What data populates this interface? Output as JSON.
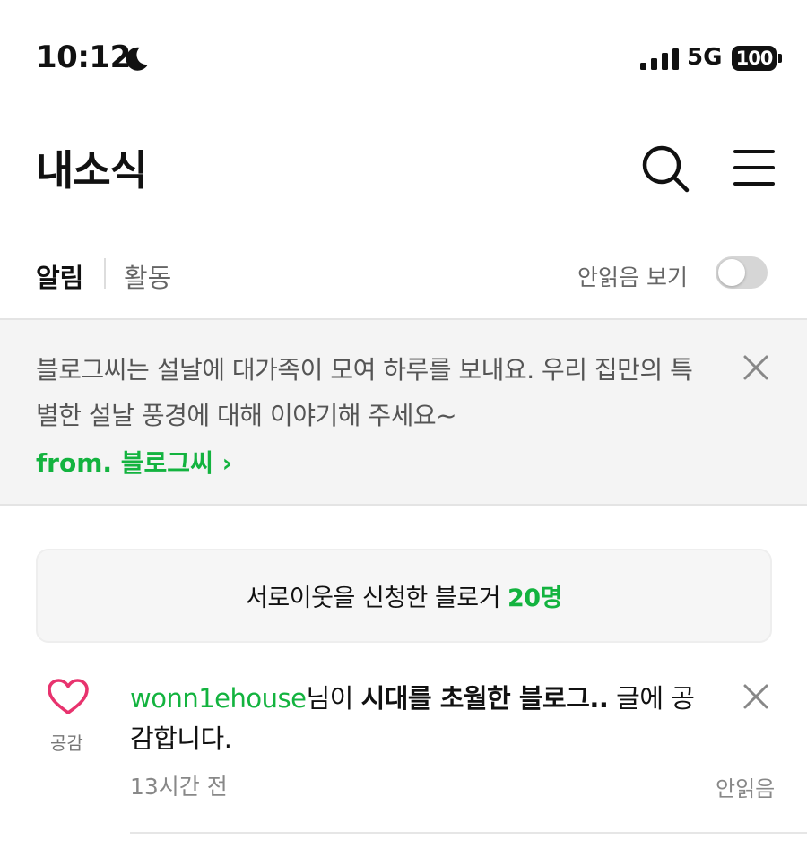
{
  "status_bar": {
    "time": "10:12",
    "network": "5G",
    "battery": "100",
    "icons": [
      "moon-icon",
      "signal-icon",
      "battery-icon"
    ]
  },
  "header": {
    "title": "내소식",
    "icons": [
      "search-icon",
      "menu-icon"
    ]
  },
  "tabs": {
    "alert": "알림",
    "activity": "활동",
    "unread_toggle_label": "안읽음 보기",
    "unread_toggle_on": false
  },
  "notice": {
    "message": "블로그씨는 설날에 대가족이 모여 하루를 보내요. 우리 집만의 특별한 설날 풍경에 대해 이야기해 주세요~",
    "from": "from. 블로그씨 ›",
    "close_icon": "close-icon"
  },
  "neighbor_request": {
    "text": "서로이웃을 신청한 블로거",
    "count": "20명"
  },
  "notifications": [
    {
      "icon": "heart-icon",
      "icon_label": "공감",
      "user": "wonn1ehouse",
      "text_before": "님이 ",
      "post_title": "시대를 초월한 블로그..",
      "text_after": " 글에 공감합니다.",
      "time": "13시간 전",
      "status": "안읽음"
    }
  ],
  "colors": {
    "accent": "#13b33f",
    "heart": "#e8336e",
    "notice_bg": "#f4f4f4"
  }
}
